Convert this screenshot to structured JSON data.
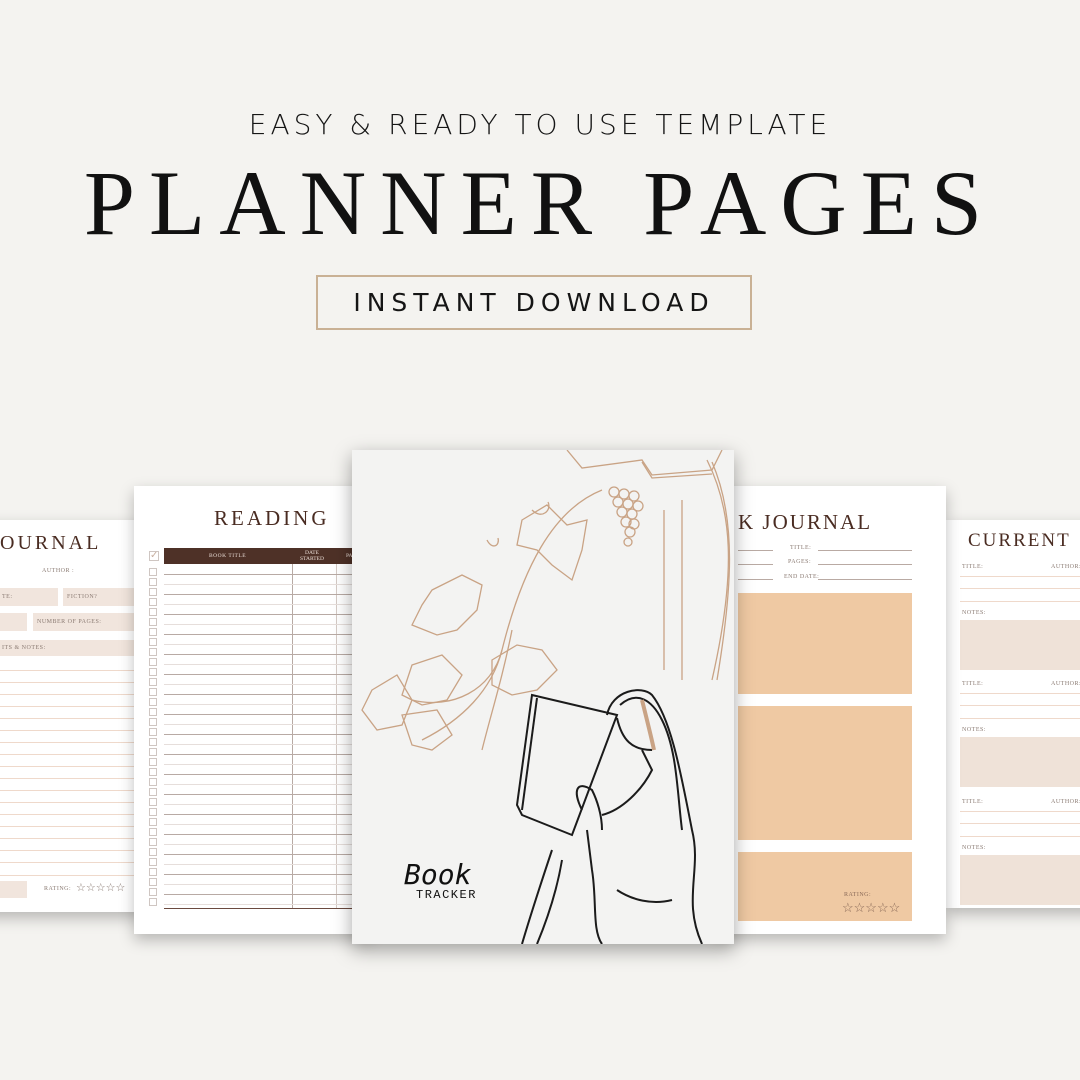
{
  "header": {
    "subtitle": "EASY & READY TO USE TEMPLATE",
    "title": "PLANNER PAGES",
    "cta_label": "INSTANT DOWNLOAD"
  },
  "colors": {
    "background": "#f4f3f0",
    "accent_border": "#c9b195",
    "title_brown": "#4a2c22",
    "table_header": "#4e3127",
    "peach": "#efc9a3",
    "blush": "#f1e5dd",
    "illustration_tan": "#c9a385"
  },
  "pages": {
    "book_journal_left": {
      "title": "OURNAL",
      "author_label": "AUTHOR :",
      "field_date": "TE:",
      "field_fiction": "FICTION?",
      "field_pages": "NUMBER OF PAGES:",
      "field_notes": "ITS & NOTES:",
      "rating_label": "RATING:",
      "rating_stars": "☆☆☆☆☆"
    },
    "reading_log": {
      "title": "READING",
      "columns": [
        "BOOK TITLE",
        "DATE STARTED",
        "PA"
      ],
      "check_icon": "✓"
    },
    "cover": {
      "title": "Book",
      "subtitle": "TRACKER"
    },
    "book_journal_right": {
      "title": "K JOURNAL",
      "fields": [
        "TITLE:",
        "PAGES:",
        "END DATE:"
      ],
      "rating_label": "RATING:",
      "rating_stars": "☆☆☆☆☆"
    },
    "current_reads": {
      "title": "CURRENT",
      "title_label": "TITLE:",
      "author_label": "AUTHOR:",
      "notes_label": "NOTES:"
    }
  }
}
